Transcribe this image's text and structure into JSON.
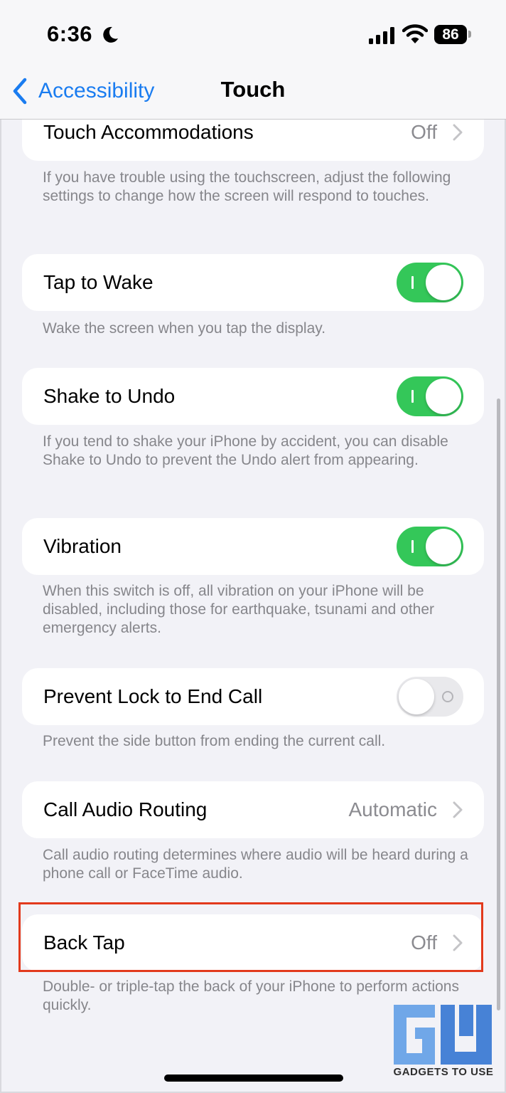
{
  "status_bar": {
    "time": "6:36",
    "battery": "86"
  },
  "nav": {
    "back_label": "Accessibility",
    "title": "Touch"
  },
  "rows": [
    {
      "label": "Touch Accommodations",
      "value": "Off",
      "footer": "If you have trouble using the touchscreen, adjust the following settings to change how the screen will respond to touches."
    },
    {
      "label": "Tap to Wake",
      "toggle_on": true,
      "footer": "Wake the screen when you tap the display."
    },
    {
      "label": "Shake to Undo",
      "toggle_on": true,
      "footer": "If you tend to shake your iPhone by accident, you can disable Shake to Undo to prevent the Undo alert from appearing."
    },
    {
      "label": "Vibration",
      "toggle_on": true,
      "footer": "When this switch is off, all vibration on your iPhone will be disabled, including those for earthquake, tsunami and other emergency alerts."
    },
    {
      "label": "Prevent Lock to End Call",
      "toggle_on": false,
      "footer": "Prevent the side button from ending the current call."
    },
    {
      "label": "Call Audio Routing",
      "value": "Automatic",
      "footer": "Call audio routing determines where audio will be heard during a phone call or FaceTime audio."
    },
    {
      "label": "Back Tap",
      "value": "Off",
      "footer": "Double- or triple-tap the back of your iPhone to perform actions quickly."
    }
  ],
  "watermark": {
    "text": "GADGETS TO USE"
  },
  "colors": {
    "accent": "#1a7cf0",
    "toggle_on": "#34c759",
    "highlight": "#e23a1d"
  }
}
